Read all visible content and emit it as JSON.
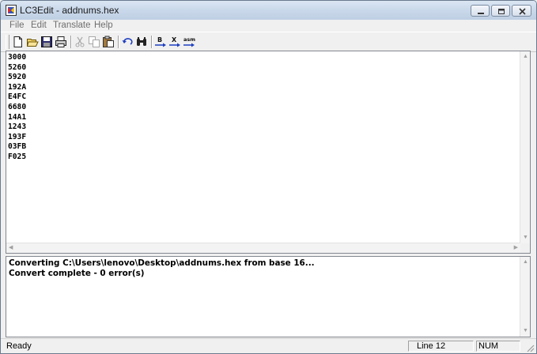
{
  "window": {
    "title": "LC3Edit - addnums.hex"
  },
  "menu": [
    "File",
    "Edit",
    "Translate",
    "Help"
  ],
  "toolbar": {
    "buttons": [
      "new-file",
      "open-folder",
      "save",
      "print",
      "cut",
      "copy",
      "paste",
      "undo",
      "find",
      "B",
      "X",
      "asm"
    ]
  },
  "editor": {
    "lines": [
      "3000",
      "5260",
      "5920",
      "192A",
      "E4FC",
      "6680",
      "14A1",
      "1243",
      "193F",
      "03FB",
      "F025"
    ]
  },
  "output": {
    "lines": [
      "Converting C:\\Users\\lenovo\\Desktop\\addnums.hex from base 16...",
      "Convert complete - 0 error(s)"
    ]
  },
  "status": {
    "ready": "Ready",
    "line": "Line 12",
    "mode": "NUM"
  },
  "colors": {
    "accent_blue": "#1f3fbf",
    "titlebar": "#c9d8ea"
  }
}
